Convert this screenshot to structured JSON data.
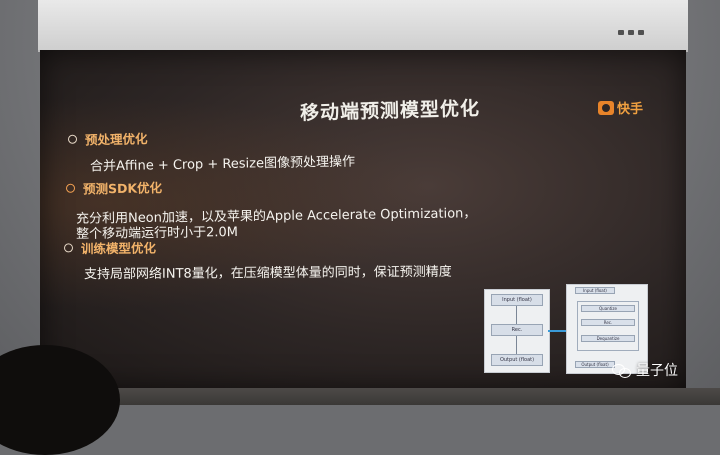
{
  "slide": {
    "title": "移动端预测模型优化",
    "brand": "快手",
    "sections": [
      {
        "heading": "预处理优化",
        "lines": [
          "合并Affine + Crop + Resize图像预处理操作"
        ]
      },
      {
        "heading": "预测SDK优化",
        "lines": [
          "充分利用Neon加速，以及苹果的Apple Accelerate Optimization，",
          "整个移动端运行时小于2.0M"
        ]
      },
      {
        "heading": "训练模型优化",
        "lines": [
          "支持局部网络INT8量化，在压缩模型体量的同时，保证预测精度"
        ]
      }
    ],
    "diagram": {
      "left_boxes": [
        "Input (float)",
        "Rec.",
        "Output (float)"
      ],
      "right_boxes": [
        "Input (float)",
        "Quantize",
        "Rec.",
        "Dequantize",
        "Output (float)"
      ]
    }
  },
  "watermark": "量子位",
  "colors": {
    "heading": "#f2b36a",
    "brand": "#f0a040",
    "text": "#f5f3ee",
    "arrow": "#3a9ad8"
  }
}
